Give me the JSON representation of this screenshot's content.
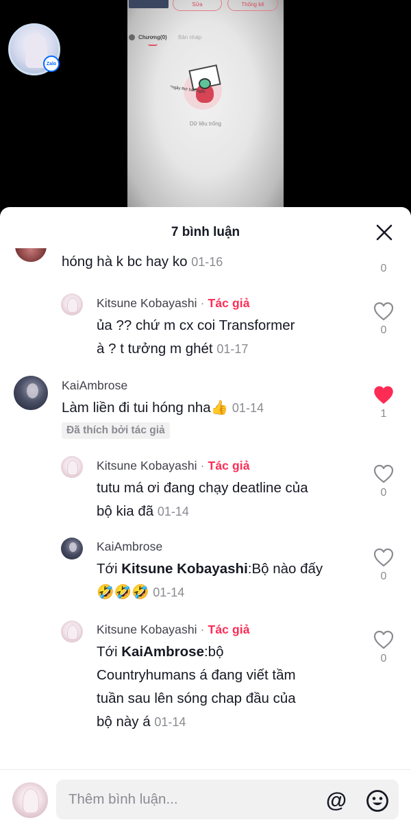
{
  "video": {
    "shot_buttons": [
      "Sửa",
      "Thống kê"
    ],
    "shot_tabs": [
      "Chương(0)",
      "Bản nháp"
    ],
    "shot_note": "*ngây thơ bán ngốc",
    "shot_empty_text": "Dữ liệu trống",
    "zalo_badge": "Zalo"
  },
  "sheet": {
    "title": "7 bình luận"
  },
  "comments": [
    {
      "id": "partial",
      "text": "hóng hà k bc hay ko",
      "date": "01-16",
      "likes": "0",
      "liked": false
    },
    {
      "id": "reply-1",
      "username": "Kitsune Kobayashi",
      "separator": "·",
      "author_label": "Tác giả",
      "text_lines": [
        "ủa ?? chứ m cx coi Transformer",
        "à ? t tưởng m ghét"
      ],
      "date": "01-17",
      "likes": "0",
      "liked": false
    },
    {
      "id": "comment-kai",
      "username": "KaiAmbrose",
      "text": "Làm liền đi tui hóng nha👍",
      "date": "01-14",
      "liked_by_author": "Đã thích bởi tác giả",
      "likes": "1",
      "liked": true
    },
    {
      "id": "reply-2",
      "username": "Kitsune Kobayashi",
      "separator": "·",
      "author_label": "Tác giả",
      "text_lines": [
        "tutu má ơi đang chạy deatline của",
        "bộ kia đã"
      ],
      "date": "01-14",
      "likes": "0",
      "liked": false
    },
    {
      "id": "reply-3",
      "username": "KaiAmbrose",
      "prefix": "Tới ",
      "mention": "Kitsune Kobayashi",
      "text_after": ":Bộ nào đấy",
      "text_line2": "🤣🤣🤣",
      "date": "01-14",
      "likes": "0",
      "liked": false
    },
    {
      "id": "reply-4",
      "username": "Kitsune Kobayashi",
      "separator": "·",
      "author_label": "Tác giả",
      "prefix": "Tới ",
      "mention": "KaiAmbrose",
      "text_after": ":bộ",
      "text_lines": [
        "Countryhumans á đang viết tầm",
        "tuần sau lên sóng chap đầu của",
        "bộ này á"
      ],
      "date": "01-14",
      "likes": "0",
      "liked": false
    }
  ],
  "input": {
    "placeholder": "Thêm bình luận...",
    "at_symbol": "@"
  },
  "colors": {
    "author": "#fe2c55",
    "liked_heart": "#fe2c55",
    "muted": "#8a8b91"
  }
}
